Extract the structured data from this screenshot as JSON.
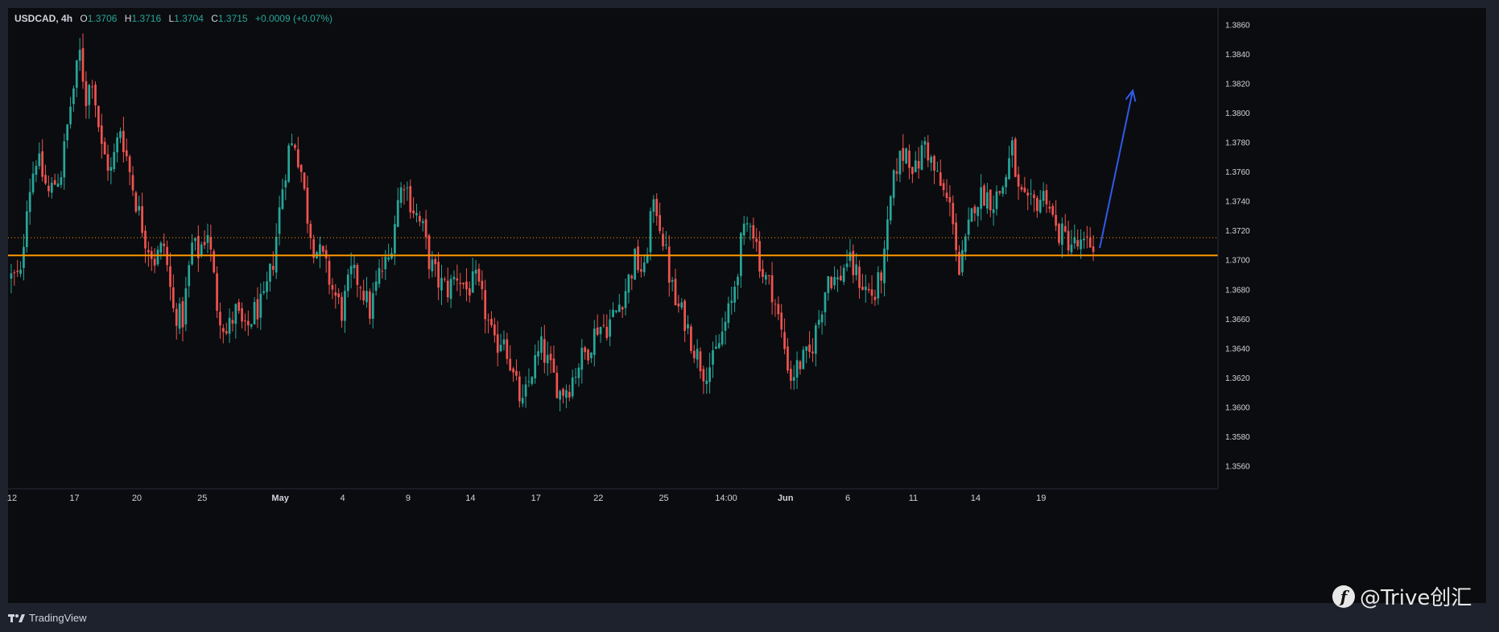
{
  "legend": {
    "symbol": "USDCAD",
    "interval": "4h",
    "open_label": "O",
    "open": "1.3706",
    "high_label": "H",
    "high": "1.3716",
    "low_label": "L",
    "low": "1.3704",
    "close_label": "C",
    "close": "1.3715",
    "change": "+0.0009 (+0.07%)"
  },
  "footer": {
    "brand": "TradingView"
  },
  "watermark": {
    "icon_letter": "f",
    "text": "@Trive创汇"
  },
  "colors": {
    "background": "#0b0c0f",
    "frame": "#1e222d",
    "up": "#26a69a",
    "down": "#ef5350",
    "support_line": "#ff9800",
    "arrow": "#2f5bea",
    "axis_text": "#d1d4dc"
  },
  "chart_data": {
    "type": "candlestick",
    "symbol": "USDCAD",
    "interval": "4h",
    "ylim": [
      1.3545,
      1.387
    ],
    "y_ticks": [
      "1.3860",
      "1.3840",
      "1.3820",
      "1.3800",
      "1.3780",
      "1.3760",
      "1.3740",
      "1.3720",
      "1.3700",
      "1.3680",
      "1.3660",
      "1.3640",
      "1.3620",
      "1.3600",
      "1.3580",
      "1.3560"
    ],
    "x_ticks": [
      "12",
      "17",
      "20",
      "25",
      "May",
      "4",
      "9",
      "14",
      "17",
      "22",
      "25",
      "14:00",
      "Jun",
      "6",
      "11",
      "14",
      "19"
    ],
    "price_labels": {
      "current": "1.3715",
      "support": "1.3703"
    },
    "support_level": 1.3703,
    "current_price_level": 1.3715,
    "anchors": [
      [
        0,
        1.3688
      ],
      [
        3,
        1.3688
      ],
      [
        5,
        1.374
      ],
      [
        8,
        1.377
      ],
      [
        12,
        1.3745
      ],
      [
        16,
        1.376
      ],
      [
        19,
        1.3805
      ],
      [
        22,
        1.384
      ],
      [
        24,
        1.381
      ],
      [
        26,
        1.3825
      ],
      [
        29,
        1.3775
      ],
      [
        32,
        1.376
      ],
      [
        35,
        1.379
      ],
      [
        37,
        1.377
      ],
      [
        40,
        1.374
      ],
      [
        43,
        1.3715
      ],
      [
        46,
        1.37
      ],
      [
        49,
        1.371
      ],
      [
        52,
        1.3665
      ],
      [
        55,
        1.366
      ],
      [
        58,
        1.371
      ],
      [
        60,
        1.3705
      ],
      [
        63,
        1.372
      ],
      [
        66,
        1.367
      ],
      [
        69,
        1.365
      ],
      [
        72,
        1.3665
      ],
      [
        75,
        1.365
      ],
      [
        78,
        1.3665
      ],
      [
        81,
        1.367
      ],
      [
        84,
        1.37
      ],
      [
        87,
        1.375
      ],
      [
        89,
        1.3775
      ],
      [
        91,
        1.378
      ],
      [
        93,
        1.376
      ],
      [
        95,
        1.373
      ],
      [
        97,
        1.371
      ],
      [
        100,
        1.37
      ],
      [
        103,
        1.368
      ],
      [
        106,
        1.3665
      ],
      [
        109,
        1.369
      ],
      [
        112,
        1.3685
      ],
      [
        115,
        1.3665
      ],
      [
        118,
        1.369
      ],
      [
        121,
        1.37
      ],
      [
        124,
        1.374
      ],
      [
        126,
        1.3755
      ],
      [
        128,
        1.374
      ],
      [
        130,
        1.373
      ],
      [
        132,
        1.372
      ],
      [
        134,
        1.37
      ],
      [
        137,
        1.3685
      ],
      [
        140,
        1.368
      ],
      [
        143,
        1.369
      ],
      [
        146,
        1.368
      ],
      [
        149,
        1.3685
      ],
      [
        152,
        1.3665
      ],
      [
        155,
        1.364
      ],
      [
        158,
        1.365
      ],
      [
        161,
        1.362
      ],
      [
        164,
        1.36
      ],
      [
        167,
        1.3625
      ],
      [
        170,
        1.364
      ],
      [
        173,
        1.3625
      ],
      [
        176,
        1.361
      ],
      [
        179,
        1.3615
      ],
      [
        182,
        1.363
      ],
      [
        185,
        1.364
      ],
      [
        188,
        1.3655
      ],
      [
        191,
        1.3655
      ],
      [
        194,
        1.3665
      ],
      [
        197,
        1.368
      ],
      [
        200,
        1.37
      ],
      [
        203,
        1.369
      ],
      [
        205,
        1.373
      ],
      [
        207,
        1.3735
      ],
      [
        209,
        1.3715
      ],
      [
        211,
        1.369
      ],
      [
        213,
        1.367
      ],
      [
        216,
        1.366
      ],
      [
        219,
        1.364
      ],
      [
        222,
        1.3625
      ],
      [
        225,
        1.363
      ],
      [
        228,
        1.365
      ],
      [
        231,
        1.367
      ],
      [
        234,
        1.371
      ],
      [
        237,
        1.373
      ],
      [
        239,
        1.371
      ],
      [
        241,
        1.369
      ],
      [
        244,
        1.368
      ],
      [
        247,
        1.365
      ],
      [
        250,
        1.362
      ],
      [
        253,
        1.363
      ],
      [
        256,
        1.3635
      ],
      [
        259,
        1.366
      ],
      [
        262,
        1.369
      ],
      [
        265,
        1.3685
      ],
      [
        268,
        1.37
      ],
      [
        271,
        1.369
      ],
      [
        274,
        1.368
      ],
      [
        277,
        1.3675
      ],
      [
        280,
        1.37
      ],
      [
        282,
        1.374
      ],
      [
        284,
        1.3765
      ],
      [
        287,
        1.3775
      ],
      [
        290,
        1.376
      ],
      [
        293,
        1.378
      ],
      [
        296,
        1.376
      ],
      [
        299,
        1.3745
      ],
      [
        302,
        1.373
      ],
      [
        304,
        1.369
      ],
      [
        306,
        1.371
      ],
      [
        309,
        1.374
      ],
      [
        312,
        1.3745
      ],
      [
        315,
        1.374
      ],
      [
        318,
        1.375
      ],
      [
        321,
        1.3775
      ],
      [
        323,
        1.3745
      ],
      [
        326,
        1.3735
      ],
      [
        329,
        1.374
      ],
      [
        332,
        1.3745
      ],
      [
        335,
        1.372
      ],
      [
        338,
        1.3715
      ],
      [
        341,
        1.371
      ],
      [
        344,
        1.3708
      ],
      [
        347,
        1.3712
      ]
    ],
    "n_candles": 348,
    "forecast": {
      "from_level": 1.3708,
      "to_level": 1.3815
    }
  }
}
